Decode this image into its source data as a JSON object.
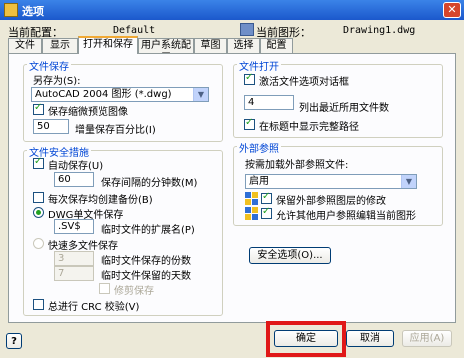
{
  "window": {
    "title": "选项"
  },
  "info": {
    "profile_label": "当前配置：",
    "profile_value": "Default",
    "drawing_label": "当前图形：",
    "drawing_value": "Drawing1.dwg"
  },
  "tabs": [
    "文件",
    "显示",
    "打开和保存",
    "用户系统配置",
    "草图",
    "选择",
    "配置"
  ],
  "active_tab": "打开和保存",
  "file_save": {
    "title": "文件保存",
    "saveas_label": "另存为(S):",
    "saveas_value": "AutoCAD 2004 图形 (*.dwg)",
    "thumbnail_label": "保存缩微预览图像",
    "thumbnail_checked": true,
    "incremental_value": "50",
    "incremental_label": "增量保存百分比(I)"
  },
  "file_safety": {
    "title": "文件安全措施",
    "autosave_label": "自动保存(U)",
    "autosave_checked": true,
    "minutes_value": "60",
    "minutes_label": "保存间隔的分钟数(M)",
    "backup_label": "每次保存均创建备份(B)",
    "single_label": "DWG单文件保存",
    "temp_ext_value": ".SV$",
    "temp_ext_label": "临时文件的扩展名(P)",
    "multi_label": "快速多文件保存",
    "temp_count_value": "3",
    "temp_count_label": "临时文件保存的份数",
    "temp_days_value": "7",
    "temp_days_label": "临时文件保留的天数",
    "prune_label": "修剪保存",
    "crc_label": "总进行 CRC 校验(V)"
  },
  "file_open": {
    "title": "文件打开",
    "dialog_label": "激活文件选项对话框",
    "recent_value": "4",
    "recent_label": "列出最近所用文件数",
    "fullpath_label": "在标题中显示完整路径"
  },
  "xref": {
    "title": "外部参照",
    "demand_label": "按需加载外部参照文件:",
    "demand_value": "启用",
    "retain_label": "保留外部参照图层的修改",
    "edit_label": "允许其他用户参照编辑当前图形"
  },
  "buttons": {
    "security": "安全选项(O)...",
    "ok": "确定",
    "cancel": "取消",
    "apply": "应用(A)",
    "help": "?"
  }
}
